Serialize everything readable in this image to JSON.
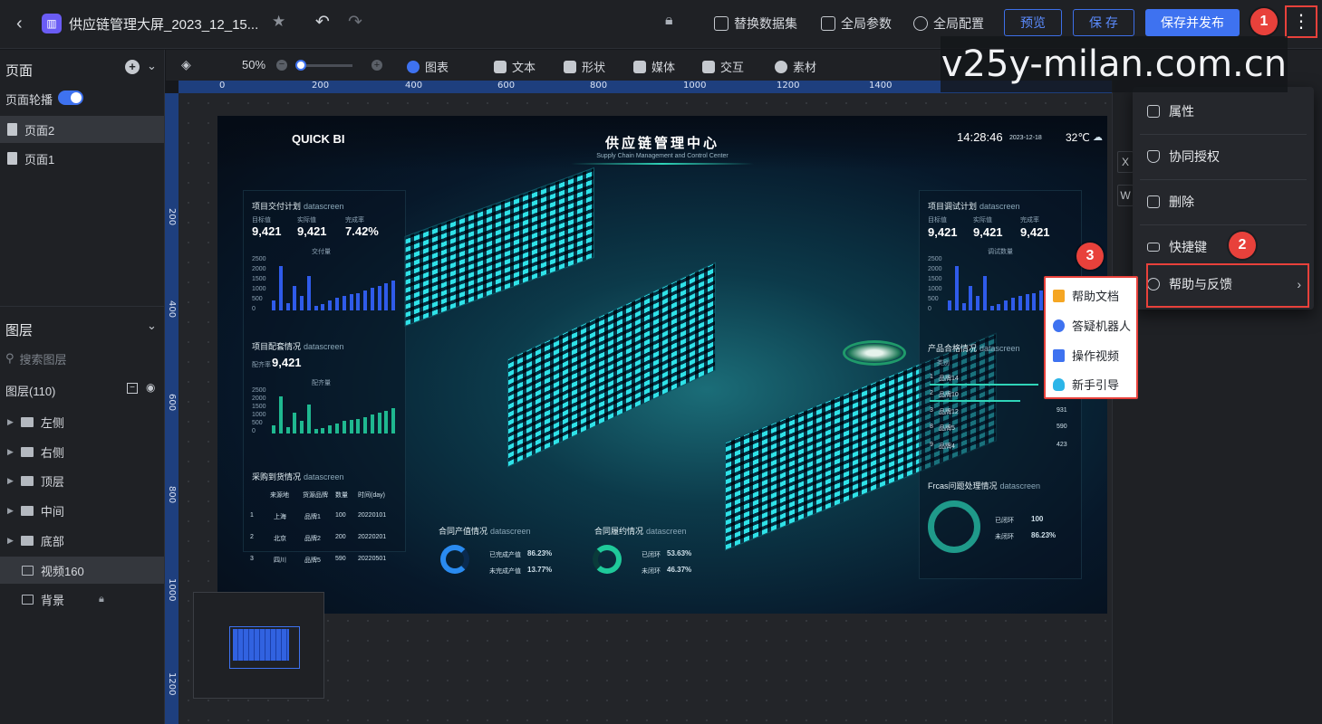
{
  "topbar": {
    "back_icon": "chevron-left-icon",
    "app_icon": "chart-app-icon",
    "title": "供应链管理大屏_2023_12_15...",
    "star_icon": "star-icon",
    "undo_icon": "undo-icon",
    "redo_icon": "redo-icon",
    "lock_icon": "lock-icon",
    "replace_dataset": "替换数据集",
    "global_params": "全局参数",
    "global_config": "全局配置",
    "preview": "预览",
    "save": "保 存",
    "save_publish": "保存并发布",
    "more_icon": "more-vertical-icon",
    "badge1": "1"
  },
  "left": {
    "pages_header": "页面",
    "carousel_label": "页面轮播",
    "carousel_on": true,
    "pages": [
      {
        "label": "页面2",
        "active": true
      },
      {
        "label": "页面1",
        "active": false
      }
    ],
    "layers_header": "图层",
    "search_placeholder": "搜索图层",
    "layers_count": "图层(110)",
    "layers": [
      {
        "label": "左侧",
        "type": "folder"
      },
      {
        "label": "右侧",
        "type": "folder"
      },
      {
        "label": "顶层",
        "type": "folder"
      },
      {
        "label": "中间",
        "type": "folder"
      },
      {
        "label": "底部",
        "type": "folder"
      },
      {
        "label": "视频160",
        "type": "image",
        "active": true
      },
      {
        "label": "背景",
        "type": "image",
        "locked": true
      }
    ]
  },
  "toolbar": {
    "zoom": "50%",
    "zoom_fraction": 0.08,
    "chart": "图表",
    "text": "文本",
    "shape": "形状",
    "media": "媒体",
    "interact": "交互",
    "material": "素材"
  },
  "ruler": {
    "h_ticks": [
      "0",
      "200",
      "400",
      "600",
      "800",
      "1000",
      "1200",
      "1400"
    ],
    "v_ticks": [
      "200",
      "400",
      "600",
      "800",
      "1000",
      "1200"
    ]
  },
  "screen": {
    "brand": "QUICK BI",
    "title": "供应链管理中心",
    "subtitle": "Supply Chain Management and Control Center",
    "time": "14:28:46",
    "date": "2023-12-18",
    "temp": "32℃",
    "left_panels": {
      "p1_title": "项目交付计划",
      "p1_en": "datascreen",
      "p1_kpis": [
        {
          "label": "目标值",
          "value": "9,421"
        },
        {
          "label": "实际值",
          "value": "9,421"
        },
        {
          "label": "完成率",
          "value": "7.42%"
        }
      ],
      "p1_legend": "交付量",
      "p1_yticks": [
        "2500",
        "2000",
        "1500",
        "1000",
        "500",
        "0"
      ],
      "p2_title": "项目配套情况",
      "p2_en": "datascreen",
      "p2_kpi_label": "配齐率",
      "p2_kpi_value": "9,421",
      "p2_legend": "配齐量",
      "p2_yticks": [
        "2500",
        "2000",
        "1500",
        "1000",
        "500",
        "0"
      ],
      "p3_title": "采购到货情况",
      "p3_en": "datascreen",
      "p3_headers": [
        "来源地",
        "货源品牌",
        "数量",
        "时间(day)"
      ],
      "p3_rows": [
        [
          "1",
          "上海",
          "品牌1",
          "100",
          "20220101"
        ],
        [
          "2",
          "北京",
          "品牌2",
          "200",
          "20220201"
        ],
        [
          "3",
          "四川",
          "品牌5",
          "590",
          "20220501"
        ]
      ]
    },
    "right_panels": {
      "p1_title": "项目调试计划",
      "p1_en": "datascreen",
      "p1_kpis": [
        {
          "label": "目标值",
          "value": "9,421"
        },
        {
          "label": "实际值",
          "value": "9,421"
        },
        {
          "label": "完成率",
          "value": "9,421"
        }
      ],
      "p1_legend": "调试数量",
      "p1_yticks": [
        "2500",
        "2000",
        "1500",
        "1000",
        "500",
        "0"
      ],
      "p2_title": "产品合格情况",
      "p2_en": "datascreen",
      "p2_col": "类别",
      "p2_rows": [
        {
          "rank": "1",
          "name": "品牌14",
          "value": ""
        },
        {
          "rank": "2",
          "name": "品牌10",
          "value": ""
        },
        {
          "rank": "3",
          "name": "品牌12",
          "value": "931"
        },
        {
          "rank": "8",
          "name": "品牌5",
          "value": "590"
        },
        {
          "rank": "9",
          "name": "品牌4",
          "value": "423"
        }
      ],
      "p3_title": "Frcas问题处理情况",
      "p3_en": "datascreen",
      "p3_items": [
        {
          "label": "已闭环",
          "value": "100"
        },
        {
          "label": "未闭环",
          "value": "86.23%"
        }
      ]
    },
    "bottom": {
      "c1_title": "合同产值情况",
      "c1_en": "datascreen",
      "c1_items": [
        {
          "label": "已完成产值",
          "value": "86.23%"
        },
        {
          "label": "未完成产值",
          "value": "13.77%"
        }
      ],
      "c2_title": "合同履约情况",
      "c2_en": "datascreen",
      "c2_items": [
        {
          "label": "已闭环",
          "value": "53.63%"
        },
        {
          "label": "未闭环",
          "value": "46.37%"
        }
      ]
    }
  },
  "right_panel": {
    "chips": [
      "X",
      "W"
    ]
  },
  "more_menu": {
    "items": [
      {
        "label": "属性",
        "icon": "properties-icon"
      },
      {
        "label": "协同授权",
        "icon": "shield-icon"
      },
      {
        "label": "删除",
        "icon": "trash-icon"
      },
      {
        "label": "快捷键",
        "icon": "keyboard-icon"
      },
      {
        "label": "帮助与反馈",
        "icon": "help-circle-icon"
      }
    ],
    "badge2": "2"
  },
  "help_submenu": {
    "badge3": "3",
    "items": [
      {
        "label": "帮助文档",
        "icon": "document-icon",
        "color": "#f5a623"
      },
      {
        "label": "答疑机器人",
        "icon": "robot-icon",
        "color": "#3e72f0"
      },
      {
        "label": "操作视频",
        "icon": "video-icon",
        "color": "#3e72f0"
      },
      {
        "label": "新手引导",
        "icon": "bulb-icon",
        "color": "#2cb5e8"
      }
    ]
  },
  "watermark": "v25y-milan.com.cn"
}
